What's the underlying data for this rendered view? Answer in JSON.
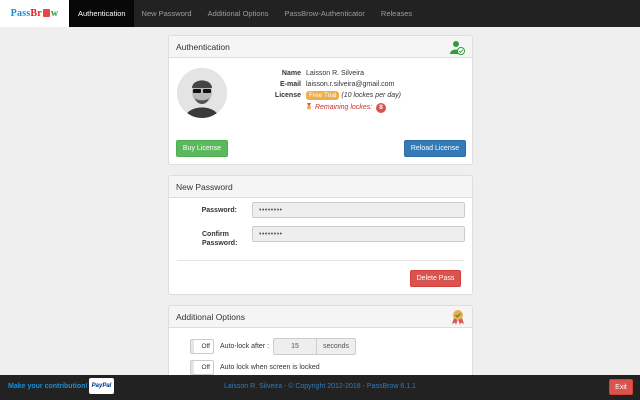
{
  "brand": {
    "text_a": "Pass",
    "text_b": "Br",
    "text_c": "w"
  },
  "nav": {
    "items": [
      {
        "label": "Authentication"
      },
      {
        "label": "New Password"
      },
      {
        "label": "Additional Options"
      },
      {
        "label": "PassBrow-Authenticator"
      },
      {
        "label": "Releases"
      }
    ]
  },
  "auth": {
    "title": "Authentication",
    "name_label": "Name",
    "name_value": "Laisson R. Silveira",
    "email_label": "E-mail",
    "email_value": "laisson.r.silveira@gmail.com",
    "license_label": "License",
    "license_badge": "Free Trial",
    "license_note": "(10 lockes per day)",
    "remaining_label": "Remaining lockes:",
    "remaining_count": "8",
    "buy_button": "Buy License",
    "reload_button": "Reload License"
  },
  "new_password": {
    "title": "New Password",
    "password_label": "Password:",
    "password_value": "••••••••",
    "confirm_label_line1": "Confirm",
    "confirm_label_line2": "Password:",
    "confirm_value": "••••••••",
    "delete_button": "Delete Pass"
  },
  "options": {
    "title": "Additional Options",
    "toggle1_label": "Off",
    "autolock_label": "Auto-lock after :",
    "autolock_value": "15",
    "autolock_unit": "seconds",
    "toggle2_label": "Off",
    "screenlock_label": "Auto lock when screen is locked"
  },
  "footer": {
    "contribution": "Make your contribution!",
    "paypal": "PayPal",
    "copyright": "Laisson R. Silveira - © Copyright 2012-2018 - PassBrow 6.1.1",
    "exit_button": "Exit"
  },
  "colors": {
    "topbar": "#222222",
    "success": "#5cb85c",
    "primary": "#337ab7",
    "danger": "#d9534f",
    "warning": "#f0ad4e"
  }
}
